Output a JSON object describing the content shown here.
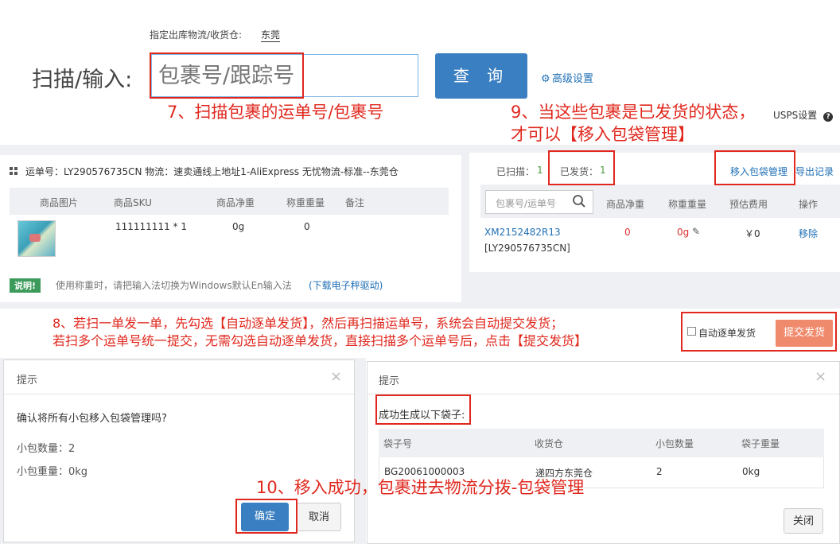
{
  "top": {
    "warehouse_label": "指定出库物流/收货仓:",
    "warehouse_value": "东莞",
    "scan_label": "扫描/输入:",
    "scan_placeholder": "包裹号/跟踪号",
    "query_button": "查 询",
    "advanced_settings": "高级设置",
    "usps_settings": "USPS设置",
    "help_icon": "question-circle-icon"
  },
  "annotations": {
    "a7": "7、扫描包裹的运单号/包裹号",
    "a9_line1": "9、当这些包裹是已发货的状态，",
    "a9_line2": "才可以【移入包袋管理】",
    "a8_line1": "8、若扫一单发一单，先勾选【自动逐单发货】，然后再扫描运单号，系统会自动提交发货；",
    "a8_line2": "若扫多个运单号统一提交，无需勾选自动逐单发货，直接扫描多个运单号后，点击【提交发货】",
    "a10": "10、移入成功，包裹进去物流分拨-包袋管理"
  },
  "left_panel": {
    "info_line": "运单号：LY290576735CN  物流：速卖通线上地址1-AliExpress 无忧物流-标准--东莞仓",
    "headers": [
      "商品图片",
      "商品SKU",
      "商品净重",
      "称重重量",
      "备注"
    ],
    "row": {
      "sku": "111111111 * 1",
      "net_weight": "0g",
      "weighed": "0"
    },
    "notice_badge": "说明!",
    "notice_text": "使用称重时，请把输入法切换为Windows默认En输入法",
    "notice_link": "(下载电子秤驱动)"
  },
  "right_panel": {
    "scanned_label": "已扫描：",
    "scanned_count": "1",
    "shipped_label": "已发货：",
    "shipped_count": "1",
    "move_bag_link": "移入包袋管理",
    "export_link": "导出记录",
    "search_placeholder": "包裹号/运单号",
    "headers": [
      "商品净重",
      "称重重量",
      "预估费用",
      "操作"
    ],
    "row": {
      "package_no": "XM2152482R13",
      "tracking_no": "[LY290576735CN]",
      "net_weight": "0",
      "weighed": "0g",
      "fee": "￥0",
      "action": "移除"
    },
    "auto_ship_label": "自动逐单发货",
    "submit_button": "提交发货"
  },
  "dialog_left": {
    "title": "提示",
    "question": "确认将所有小包移入包袋管理吗?",
    "count_label": "小包数量：2",
    "weight_label": "小包重量：0kg",
    "ok_button": "确定",
    "cancel_button": "取消"
  },
  "dialog_right": {
    "title": "提示",
    "success_text": "成功生成以下袋子:",
    "headers": [
      "袋子号",
      "收货仓",
      "小包数量",
      "袋子重量"
    ],
    "row": {
      "bag_no": "BG20061000003",
      "warehouse": "递四方东莞仓",
      "count": "2",
      "weight": "0kg"
    },
    "close_button": "关闭"
  },
  "colors": {
    "primary": "#3a7fc1",
    "annotation_red": "#e0281e",
    "submit_orange": "#f08a6c",
    "green_badge": "#3c9b5b",
    "count_green": "#4a9d3c",
    "link_blue": "#1f6fb5",
    "red_value": "#d9322e"
  }
}
